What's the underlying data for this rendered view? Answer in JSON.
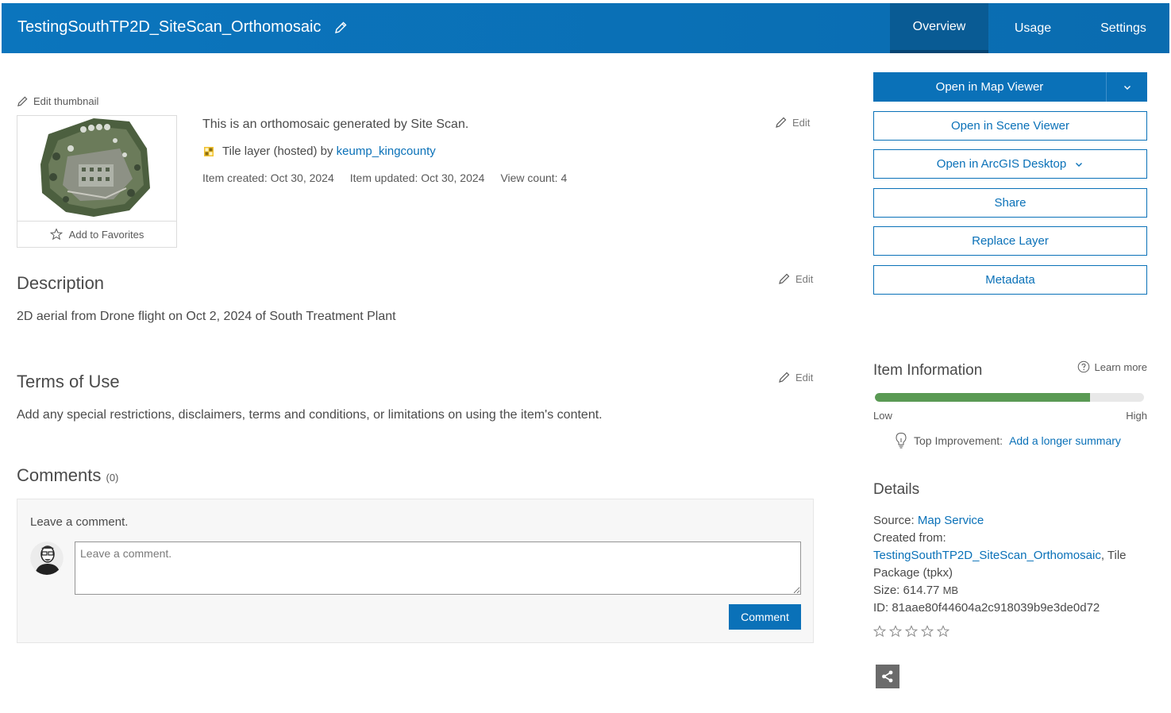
{
  "header": {
    "title": "TestingSouthTP2D_SiteScan_Orthomosaic",
    "tabs": [
      "Overview",
      "Usage",
      "Settings"
    ],
    "active_tab": "Overview"
  },
  "thumbnail": {
    "edit_label": "Edit thumbnail",
    "favorites_label": "Add to Favorites"
  },
  "summary": {
    "text": "This is an orthomosaic generated by Site Scan.",
    "type_prefix": "Tile layer (hosted) by",
    "owner": "keump_kingcounty",
    "created": "Item created: Oct 30, 2024",
    "updated": "Item updated: Oct 30, 2024",
    "views": "View count: 4",
    "edit_label": "Edit"
  },
  "description": {
    "heading": "Description",
    "text": "2D aerial from Drone flight on Oct 2, 2024 of South Treatment Plant",
    "edit_label": "Edit"
  },
  "terms": {
    "heading": "Terms of Use",
    "link": "Add any special restrictions, disclaimers, terms and conditions, or limitations on using the item's content.",
    "edit_label": "Edit"
  },
  "comments": {
    "heading": "Comments",
    "count": "(0)",
    "prompt": "Leave a comment.",
    "placeholder": "Leave a comment.",
    "button": "Comment"
  },
  "actions": {
    "map_viewer": "Open in Map Viewer",
    "scene_viewer": "Open in Scene Viewer",
    "arcgis_desktop": "Open in ArcGIS Desktop",
    "share": "Share",
    "replace_layer": "Replace Layer",
    "metadata": "Metadata"
  },
  "item_info": {
    "heading": "Item Information",
    "learn_more": "Learn more",
    "score_fraction": 0.8,
    "low": "Low",
    "high": "High",
    "improvement_label": "Top Improvement:",
    "improvement_link": "Add a longer summary"
  },
  "details": {
    "heading": "Details",
    "source_label": "Source:",
    "source_value": "Map Service",
    "created_from_label": "Created from:",
    "created_from_link": "TestingSouthTP2D_SiteScan_Orthomosaic",
    "created_from_suffix": ", Tile Package (tpkx)",
    "size_label": "Size: 614.77",
    "size_unit": "MB",
    "id": "ID: 81aae80f44604a2c918039b9e3de0d72",
    "rating_stars": 0
  },
  "colors": {
    "brand": "#0a71b8",
    "header_active": "#095b94",
    "score_bar": "#5a9a54"
  }
}
